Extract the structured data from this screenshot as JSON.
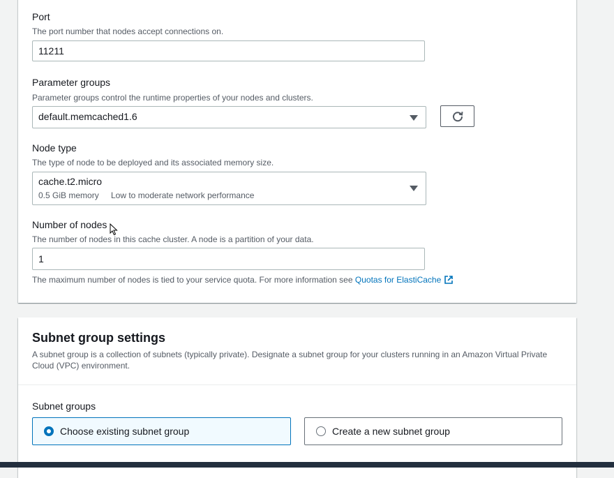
{
  "port": {
    "label": "Port",
    "description": "The port number that nodes accept connections on.",
    "value": "11211"
  },
  "parameter_groups": {
    "label": "Parameter groups",
    "description": "Parameter groups control the runtime properties of your nodes and clusters.",
    "selected": "default.memcached1.6",
    "refresh_icon": "refresh-icon"
  },
  "node_type": {
    "label": "Node type",
    "description": "The type of node to be deployed and its associated memory size.",
    "selected": "cache.t2.micro",
    "memory": "0.5 GiB memory",
    "network": "Low to moderate network performance"
  },
  "number_of_nodes": {
    "label": "Number of nodes",
    "description": "The number of nodes in this cache cluster. A node is a partition of your data.",
    "value": "1",
    "hint": "The maximum number of nodes is tied to your service quota. For more information see",
    "link": "Quotas for ElastiCache"
  },
  "subnet_settings": {
    "title": "Subnet group settings",
    "description": "A subnet group is a collection of subnets (typically private). Designate a subnet group for your clusters running in an Amazon Virtual Private Cloud (VPC) environment.",
    "subnet_groups_label": "Subnet groups",
    "options": [
      {
        "label": "Choose existing subnet group",
        "selected": true
      },
      {
        "label": "Create a new subnet group",
        "selected": false
      }
    ]
  },
  "colors": {
    "accent": "#0073bb",
    "selected_tile_bg": "#f1faff",
    "text": "#16191f",
    "muted": "#545b64",
    "bottom_bar": "#232f3e"
  }
}
